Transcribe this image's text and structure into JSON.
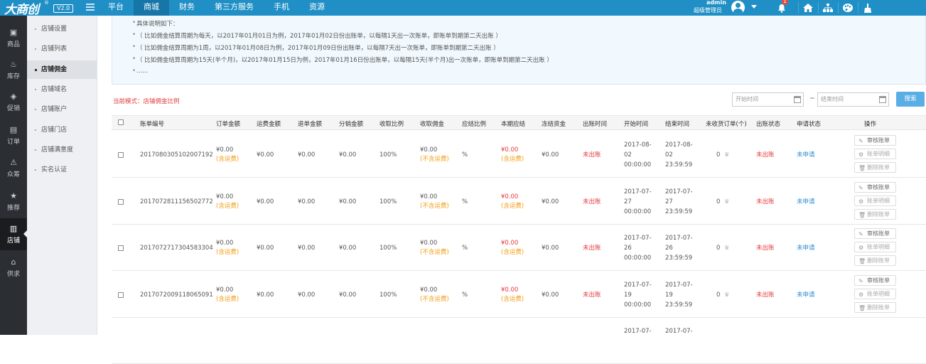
{
  "header": {
    "logo_text": "大商创",
    "logo_reg": "®",
    "version": "V2.0",
    "nav": [
      "平台",
      "商城",
      "财务",
      "第三方服务",
      "手机",
      "资源"
    ],
    "nav_active": 1,
    "user_name": "admin",
    "user_role": "超级管理员",
    "notification_count": "1",
    "icons": [
      "bell-icon",
      "home-icon",
      "sitemap-icon",
      "palette-icon",
      "broom-icon"
    ]
  },
  "sidebar": {
    "items": [
      {
        "label": "商品",
        "icon": "box-icon"
      },
      {
        "label": "库存",
        "icon": "stock-icon"
      },
      {
        "label": "促销",
        "icon": "tag-icon"
      },
      {
        "label": "订单",
        "icon": "clipboard-icon"
      },
      {
        "label": "众筹",
        "icon": "crowdfund-icon"
      },
      {
        "label": "推荐",
        "icon": "star-icon"
      },
      {
        "label": "店铺",
        "icon": "store-icon"
      },
      {
        "label": "供求",
        "icon": "house-icon"
      }
    ],
    "active_index": 6
  },
  "submenu": {
    "items": [
      "店铺设置",
      "店铺列表",
      "店铺佣金",
      "店铺域名",
      "店铺账户",
      "店铺门店",
      "店铺满意度",
      "实名认证"
    ],
    "active_index": 2
  },
  "notes": [
    "具体说明如下：",
    "（ 比如佣金结算周期为每天，以2017年01月01日为例，2017年01月02日份出账单，以每隔1天出一次账单，即账单到期第二天出账 ）",
    "（ 比如佣金结算周期为1周，以2017年01月08日为例，2017年01月09日份出账单，以每隔7天出一次账单，即账单到期第二天出账 ）",
    "（ 比如佣金结算周期为15天(半个月)，以2017年01月15日为例，2017年01月16日份出账单，以每隔15天(半个月)出一次账单，即账单到期第二天出账 ）",
    "......"
  ],
  "mode": {
    "label": "当前模式：",
    "value": "店铺佣金比例"
  },
  "filter": {
    "start_placeholder": "开始时间",
    "separator": "~",
    "end_placeholder": "结束时间",
    "search_label": "搜索"
  },
  "table": {
    "columns": [
      "账单编号",
      "订单金额",
      "运费金额",
      "退单金额",
      "分销金额",
      "收取比例",
      "收取佣金",
      "应结比例",
      "本期应结",
      "冻结资金",
      "出账时间",
      "开始时间",
      "结束时间",
      "未收货订单(个)",
      "出账状态",
      "申请状态",
      "操作"
    ],
    "rows": [
      {
        "id": "2017080305102007192",
        "order_amount": "¥0.00",
        "order_note": "(含运费)",
        "shipping": "¥0.00",
        "refund": "¥0.00",
        "distribution": "¥0.00",
        "rate": "100%",
        "commission": "¥0.00",
        "commission_note": "(不含运费)",
        "settle_rate": "%",
        "payable": "¥0.00",
        "payable_note": "(含运费)",
        "frozen": "¥0.00",
        "bill_time": "未出账",
        "start": [
          "2017-08-",
          "02",
          "00:00:00"
        ],
        "end": [
          "2017-08-",
          "02",
          "23:59:59"
        ],
        "unreceived": "0",
        "bill_status": "未出账",
        "apply_status": "未申请"
      },
      {
        "id": "2017072811156502772",
        "order_amount": "¥0.00",
        "order_note": "(含运费)",
        "shipping": "¥0.00",
        "refund": "¥0.00",
        "distribution": "¥0.00",
        "rate": "100%",
        "commission": "¥0.00",
        "commission_note": "(不含运费)",
        "settle_rate": "%",
        "payable": "¥0.00",
        "payable_note": "(含运费)",
        "frozen": "¥0.00",
        "bill_time": "未出账",
        "start": [
          "2017-07-",
          "27",
          "00:00:00"
        ],
        "end": [
          "2017-07-",
          "27",
          "23:59:59"
        ],
        "unreceived": "0",
        "bill_status": "未出账",
        "apply_status": "未申请"
      },
      {
        "id": "2017072717304583304",
        "order_amount": "¥0.00",
        "order_note": "(含运费)",
        "shipping": "¥0.00",
        "refund": "¥0.00",
        "distribution": "¥0.00",
        "rate": "100%",
        "commission": "¥0.00",
        "commission_note": "(不含运费)",
        "settle_rate": "%",
        "payable": "¥0.00",
        "payable_note": "(含运费)",
        "frozen": "¥0.00",
        "bill_time": "未出账",
        "start": [
          "2017-07-",
          "26",
          "00:00:00"
        ],
        "end": [
          "2017-07-",
          "26",
          "23:59:59"
        ],
        "unreceived": "0",
        "bill_status": "未出账",
        "apply_status": "未申请"
      },
      {
        "id": "2017072009118065091",
        "order_amount": "¥0.00",
        "order_note": "(含运费)",
        "shipping": "¥0.00",
        "refund": "¥0.00",
        "distribution": "¥0.00",
        "rate": "100%",
        "commission": "¥0.00",
        "commission_note": "(不含运费)",
        "settle_rate": "%",
        "payable": "¥0.00",
        "payable_note": "(含运费)",
        "frozen": "¥0.00",
        "bill_time": "未出账",
        "start": [
          "2017-07-",
          "19",
          "00:00:00"
        ],
        "end": [
          "2017-07-",
          "19",
          "23:59:59"
        ],
        "unreceived": "0",
        "bill_status": "未出账",
        "apply_status": "未申请"
      },
      {
        "id": "",
        "start": [
          "2017-07-"
        ],
        "end": [
          "2017-07-"
        ]
      }
    ],
    "actions": [
      "审核账单",
      "账单明细",
      "删除账单"
    ]
  },
  "colors": {
    "topbar": "#1f8fc6",
    "sidebar": "#2b2e33",
    "red": "#e4393c",
    "orange": "#f39c12",
    "blue": "#2a8bd6",
    "search_button": "#5aaee6"
  }
}
